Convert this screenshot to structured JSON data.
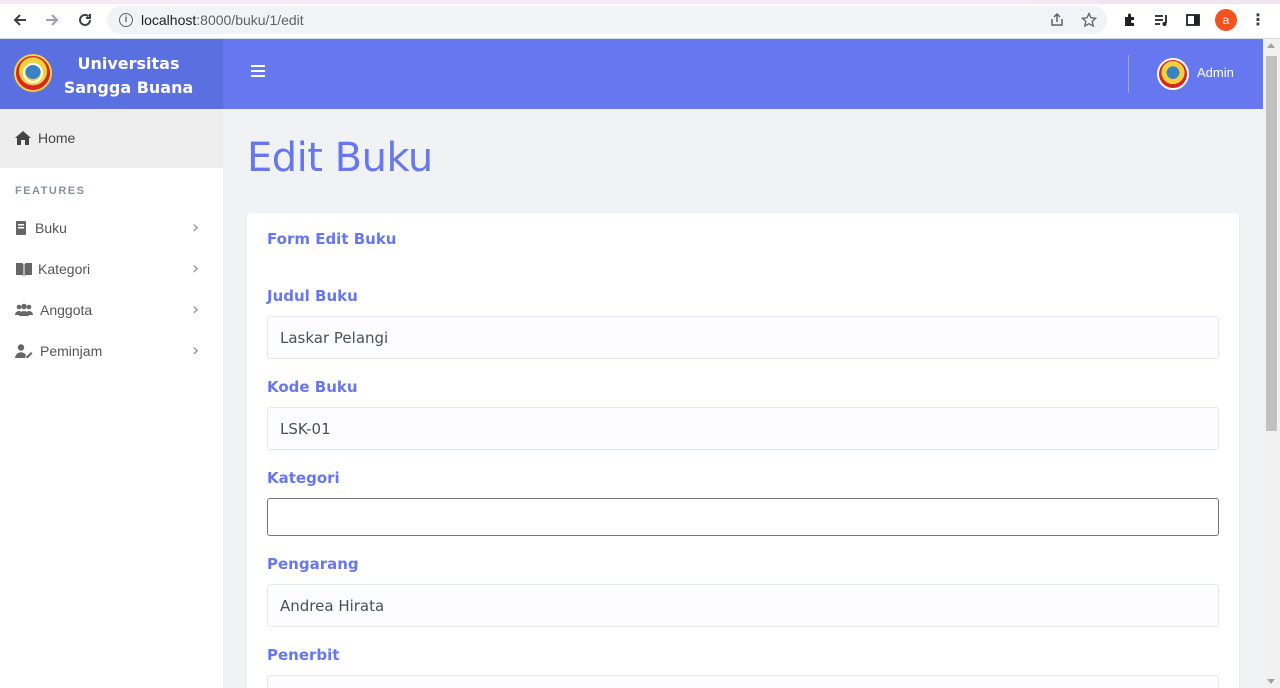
{
  "browser": {
    "url_host": "localhost",
    "url_rest": ":8000/buku/1/edit",
    "profile_initial": "a"
  },
  "brand": {
    "name_line1": "Universitas",
    "name_line2": "Sangga Buana"
  },
  "sidebar": {
    "home_label": "Home",
    "section_label": "FEATURES",
    "items": [
      {
        "label": "Buku",
        "icon": "book-icon"
      },
      {
        "label": "Kategori",
        "icon": "open-book-icon"
      },
      {
        "label": "Anggota",
        "icon": "users-icon"
      },
      {
        "label": "Peminjam",
        "icon": "user-edit-icon"
      }
    ]
  },
  "topbar": {
    "user_name": "Admin"
  },
  "main": {
    "page_title": "Edit Buku",
    "card_title": "Form Edit Buku",
    "fields": [
      {
        "label": "Judul Buku",
        "value": "Laskar Pelangi"
      },
      {
        "label": "Kode Buku",
        "value": "LSK-01"
      },
      {
        "label": "Kategori",
        "value": ""
      },
      {
        "label": "Pengarang",
        "value": "Andrea Hirata"
      },
      {
        "label": "Penerbit",
        "value": ""
      }
    ]
  },
  "colors": {
    "primary": "#6777ef",
    "brand_bg": "#5a6fe0",
    "page_bg": "#f1f2f4"
  }
}
